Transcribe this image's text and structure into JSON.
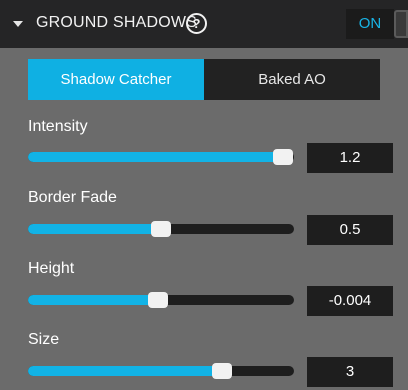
{
  "header": {
    "title": "GROUND SHADOWS",
    "help_glyph": "?",
    "toggle_label": "ON"
  },
  "mode_tabs": {
    "items": [
      "Shadow Catcher",
      "Baked AO"
    ],
    "selected": "Shadow Catcher"
  },
  "sliders": [
    {
      "label": "Intensity",
      "value": "1.2",
      "fill_fraction": 0.96
    },
    {
      "label": "Border Fade",
      "value": "0.5",
      "fill_fraction": 0.5
    },
    {
      "label": "Height",
      "value": "-0.004",
      "fill_fraction": 0.49
    },
    {
      "label": "Size",
      "value": "3",
      "fill_fraction": 0.73
    }
  ],
  "colors": {
    "accent": "#12b3e6",
    "panel_bg": "#6b6b6b",
    "header_bg": "#252526",
    "control_bg": "#1e1e1e"
  },
  "icons": {
    "collapse": "triangle-down-icon",
    "help": "help-circle-icon"
  }
}
